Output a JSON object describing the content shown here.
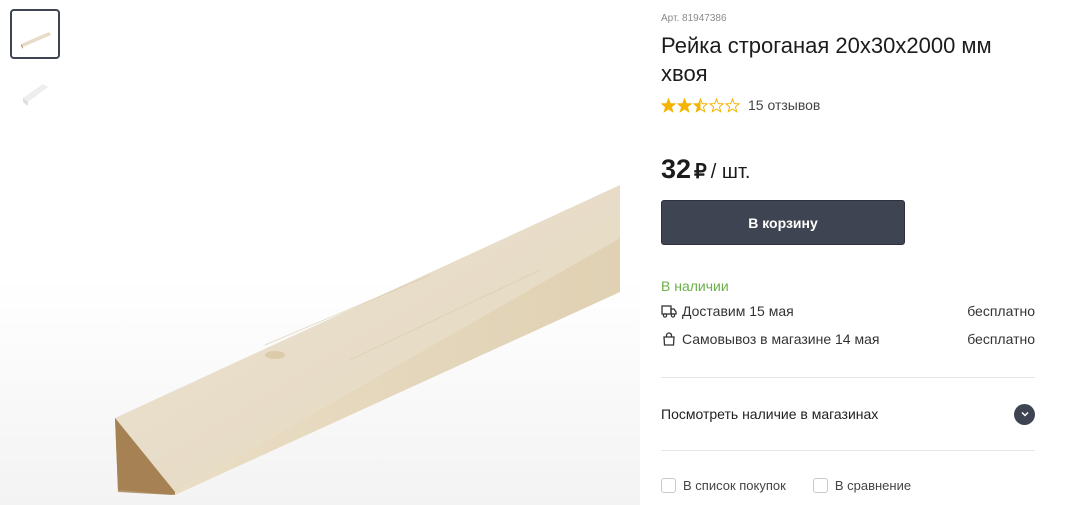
{
  "gallery": {
    "thumbnails": [
      {
        "icon": "wood-plank-thumbnail",
        "active": true
      },
      {
        "icon": "wood-plank-thumbnail-alt",
        "active": false
      }
    ],
    "main_image": "wood-plank-image"
  },
  "product": {
    "sku": "Арт. 81947386",
    "title": "Рейка строганая 20х30х2000 мм хвоя",
    "rating": 2.5,
    "rating_max": 5,
    "reviews": "15 отзывов",
    "price": "32",
    "currency": "₽",
    "unit": "/ шт.",
    "cart_button": "В корзину",
    "stock_status": "В наличии",
    "delivery": {
      "label": "Доставим 15 мая",
      "cost": "бесплатно",
      "icon": "truck-icon"
    },
    "pickup": {
      "label": "Самовывоз в магазине 14 мая",
      "cost": "бесплатно",
      "icon": "bag-icon"
    },
    "stores_link": "Посмотреть наличие в магазинах",
    "shopping_list": "В список покупок",
    "compare": "В сравнение"
  },
  "colors": {
    "button": "#3e4451",
    "star": "#f5b400",
    "in_stock": "#6cb04a"
  }
}
